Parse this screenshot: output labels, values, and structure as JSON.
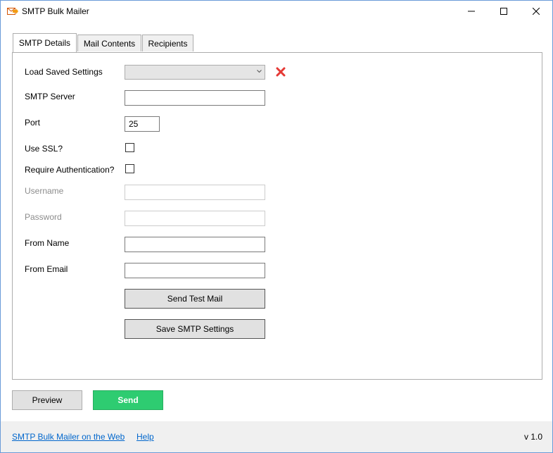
{
  "window": {
    "title": "SMTP Bulk Mailer"
  },
  "tabs": [
    {
      "label": "SMTP Details",
      "active": true
    },
    {
      "label": "Mail Contents",
      "active": false
    },
    {
      "label": "Recipients",
      "active": false
    }
  ],
  "form": {
    "load_saved_label": "Load Saved Settings",
    "load_saved_value": "",
    "smtp_server_label": "SMTP Server",
    "smtp_server_value": "",
    "port_label": "Port",
    "port_value": "25",
    "use_ssl_label": "Use SSL?",
    "use_ssl_checked": false,
    "require_auth_label": "Require Authentication?",
    "require_auth_checked": false,
    "username_label": "Username",
    "username_value": "",
    "password_label": "Password",
    "password_value": "",
    "from_name_label": "From Name",
    "from_name_value": "",
    "from_email_label": "From Email",
    "from_email_value": "",
    "send_test_label": "Send Test Mail",
    "save_settings_label": "Save SMTP Settings"
  },
  "actions": {
    "preview_label": "Preview",
    "send_label": "Send"
  },
  "footer": {
    "web_link": "SMTP Bulk Mailer on the Web",
    "help_link": "Help",
    "version": "v 1.0"
  },
  "colors": {
    "send_button": "#2ecc71",
    "link": "#0066cc",
    "delete_icon": "#e53935"
  },
  "icons": {
    "app": "mail-arrow-icon",
    "delete": "red-x-icon",
    "dropdown": "chevron-down-icon"
  }
}
